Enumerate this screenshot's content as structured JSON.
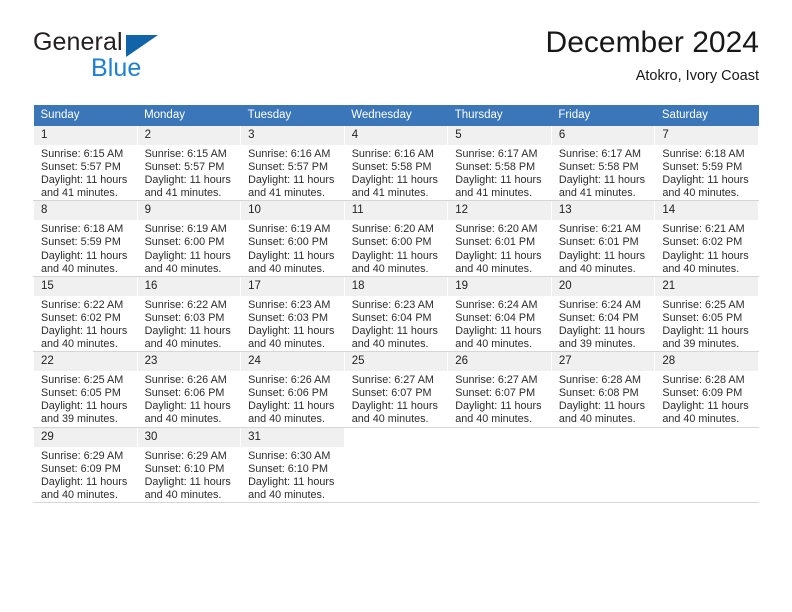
{
  "brand": {
    "name_part1": "General",
    "name_part2": "Blue",
    "triangle_color": "#1264a8",
    "blue_color": "#1f7fd4"
  },
  "header": {
    "title": "December 2024",
    "subtitle": "Atokro, Ivory Coast"
  },
  "colors": {
    "header_row": "#3a76b8",
    "daynum_bg": "#f0f0f0",
    "row_divider": "#bfbfbf",
    "text": "#2c2c2c"
  },
  "weekdays": [
    "Sunday",
    "Monday",
    "Tuesday",
    "Wednesday",
    "Thursday",
    "Friday",
    "Saturday"
  ],
  "weeks": [
    [
      {
        "day": "1",
        "sunrise": "Sunrise: 6:15 AM",
        "sunset": "Sunset: 5:57 PM",
        "daylight1": "Daylight: 11 hours",
        "daylight2": "and 41 minutes."
      },
      {
        "day": "2",
        "sunrise": "Sunrise: 6:15 AM",
        "sunset": "Sunset: 5:57 PM",
        "daylight1": "Daylight: 11 hours",
        "daylight2": "and 41 minutes."
      },
      {
        "day": "3",
        "sunrise": "Sunrise: 6:16 AM",
        "sunset": "Sunset: 5:57 PM",
        "daylight1": "Daylight: 11 hours",
        "daylight2": "and 41 minutes."
      },
      {
        "day": "4",
        "sunrise": "Sunrise: 6:16 AM",
        "sunset": "Sunset: 5:58 PM",
        "daylight1": "Daylight: 11 hours",
        "daylight2": "and 41 minutes."
      },
      {
        "day": "5",
        "sunrise": "Sunrise: 6:17 AM",
        "sunset": "Sunset: 5:58 PM",
        "daylight1": "Daylight: 11 hours",
        "daylight2": "and 41 minutes."
      },
      {
        "day": "6",
        "sunrise": "Sunrise: 6:17 AM",
        "sunset": "Sunset: 5:58 PM",
        "daylight1": "Daylight: 11 hours",
        "daylight2": "and 41 minutes."
      },
      {
        "day": "7",
        "sunrise": "Sunrise: 6:18 AM",
        "sunset": "Sunset: 5:59 PM",
        "daylight1": "Daylight: 11 hours",
        "daylight2": "and 40 minutes."
      }
    ],
    [
      {
        "day": "8",
        "sunrise": "Sunrise: 6:18 AM",
        "sunset": "Sunset: 5:59 PM",
        "daylight1": "Daylight: 11 hours",
        "daylight2": "and 40 minutes."
      },
      {
        "day": "9",
        "sunrise": "Sunrise: 6:19 AM",
        "sunset": "Sunset: 6:00 PM",
        "daylight1": "Daylight: 11 hours",
        "daylight2": "and 40 minutes."
      },
      {
        "day": "10",
        "sunrise": "Sunrise: 6:19 AM",
        "sunset": "Sunset: 6:00 PM",
        "daylight1": "Daylight: 11 hours",
        "daylight2": "and 40 minutes."
      },
      {
        "day": "11",
        "sunrise": "Sunrise: 6:20 AM",
        "sunset": "Sunset: 6:00 PM",
        "daylight1": "Daylight: 11 hours",
        "daylight2": "and 40 minutes."
      },
      {
        "day": "12",
        "sunrise": "Sunrise: 6:20 AM",
        "sunset": "Sunset: 6:01 PM",
        "daylight1": "Daylight: 11 hours",
        "daylight2": "and 40 minutes."
      },
      {
        "day": "13",
        "sunrise": "Sunrise: 6:21 AM",
        "sunset": "Sunset: 6:01 PM",
        "daylight1": "Daylight: 11 hours",
        "daylight2": "and 40 minutes."
      },
      {
        "day": "14",
        "sunrise": "Sunrise: 6:21 AM",
        "sunset": "Sunset: 6:02 PM",
        "daylight1": "Daylight: 11 hours",
        "daylight2": "and 40 minutes."
      }
    ],
    [
      {
        "day": "15",
        "sunrise": "Sunrise: 6:22 AM",
        "sunset": "Sunset: 6:02 PM",
        "daylight1": "Daylight: 11 hours",
        "daylight2": "and 40 minutes."
      },
      {
        "day": "16",
        "sunrise": "Sunrise: 6:22 AM",
        "sunset": "Sunset: 6:03 PM",
        "daylight1": "Daylight: 11 hours",
        "daylight2": "and 40 minutes."
      },
      {
        "day": "17",
        "sunrise": "Sunrise: 6:23 AM",
        "sunset": "Sunset: 6:03 PM",
        "daylight1": "Daylight: 11 hours",
        "daylight2": "and 40 minutes."
      },
      {
        "day": "18",
        "sunrise": "Sunrise: 6:23 AM",
        "sunset": "Sunset: 6:04 PM",
        "daylight1": "Daylight: 11 hours",
        "daylight2": "and 40 minutes."
      },
      {
        "day": "19",
        "sunrise": "Sunrise: 6:24 AM",
        "sunset": "Sunset: 6:04 PM",
        "daylight1": "Daylight: 11 hours",
        "daylight2": "and 40 minutes."
      },
      {
        "day": "20",
        "sunrise": "Sunrise: 6:24 AM",
        "sunset": "Sunset: 6:04 PM",
        "daylight1": "Daylight: 11 hours",
        "daylight2": "and 39 minutes."
      },
      {
        "day": "21",
        "sunrise": "Sunrise: 6:25 AM",
        "sunset": "Sunset: 6:05 PM",
        "daylight1": "Daylight: 11 hours",
        "daylight2": "and 39 minutes."
      }
    ],
    [
      {
        "day": "22",
        "sunrise": "Sunrise: 6:25 AM",
        "sunset": "Sunset: 6:05 PM",
        "daylight1": "Daylight: 11 hours",
        "daylight2": "and 39 minutes."
      },
      {
        "day": "23",
        "sunrise": "Sunrise: 6:26 AM",
        "sunset": "Sunset: 6:06 PM",
        "daylight1": "Daylight: 11 hours",
        "daylight2": "and 40 minutes."
      },
      {
        "day": "24",
        "sunrise": "Sunrise: 6:26 AM",
        "sunset": "Sunset: 6:06 PM",
        "daylight1": "Daylight: 11 hours",
        "daylight2": "and 40 minutes."
      },
      {
        "day": "25",
        "sunrise": "Sunrise: 6:27 AM",
        "sunset": "Sunset: 6:07 PM",
        "daylight1": "Daylight: 11 hours",
        "daylight2": "and 40 minutes."
      },
      {
        "day": "26",
        "sunrise": "Sunrise: 6:27 AM",
        "sunset": "Sunset: 6:07 PM",
        "daylight1": "Daylight: 11 hours",
        "daylight2": "and 40 minutes."
      },
      {
        "day": "27",
        "sunrise": "Sunrise: 6:28 AM",
        "sunset": "Sunset: 6:08 PM",
        "daylight1": "Daylight: 11 hours",
        "daylight2": "and 40 minutes."
      },
      {
        "day": "28",
        "sunrise": "Sunrise: 6:28 AM",
        "sunset": "Sunset: 6:09 PM",
        "daylight1": "Daylight: 11 hours",
        "daylight2": "and 40 minutes."
      }
    ],
    [
      {
        "day": "29",
        "sunrise": "Sunrise: 6:29 AM",
        "sunset": "Sunset: 6:09 PM",
        "daylight1": "Daylight: 11 hours",
        "daylight2": "and 40 minutes."
      },
      {
        "day": "30",
        "sunrise": "Sunrise: 6:29 AM",
        "sunset": "Sunset: 6:10 PM",
        "daylight1": "Daylight: 11 hours",
        "daylight2": "and 40 minutes."
      },
      {
        "day": "31",
        "sunrise": "Sunrise: 6:30 AM",
        "sunset": "Sunset: 6:10 PM",
        "daylight1": "Daylight: 11 hours",
        "daylight2": "and 40 minutes."
      },
      {
        "day": "",
        "sunrise": "",
        "sunset": "",
        "daylight1": "",
        "daylight2": ""
      },
      {
        "day": "",
        "sunrise": "",
        "sunset": "",
        "daylight1": "",
        "daylight2": ""
      },
      {
        "day": "",
        "sunrise": "",
        "sunset": "",
        "daylight1": "",
        "daylight2": ""
      },
      {
        "day": "",
        "sunrise": "",
        "sunset": "",
        "daylight1": "",
        "daylight2": ""
      }
    ]
  ]
}
